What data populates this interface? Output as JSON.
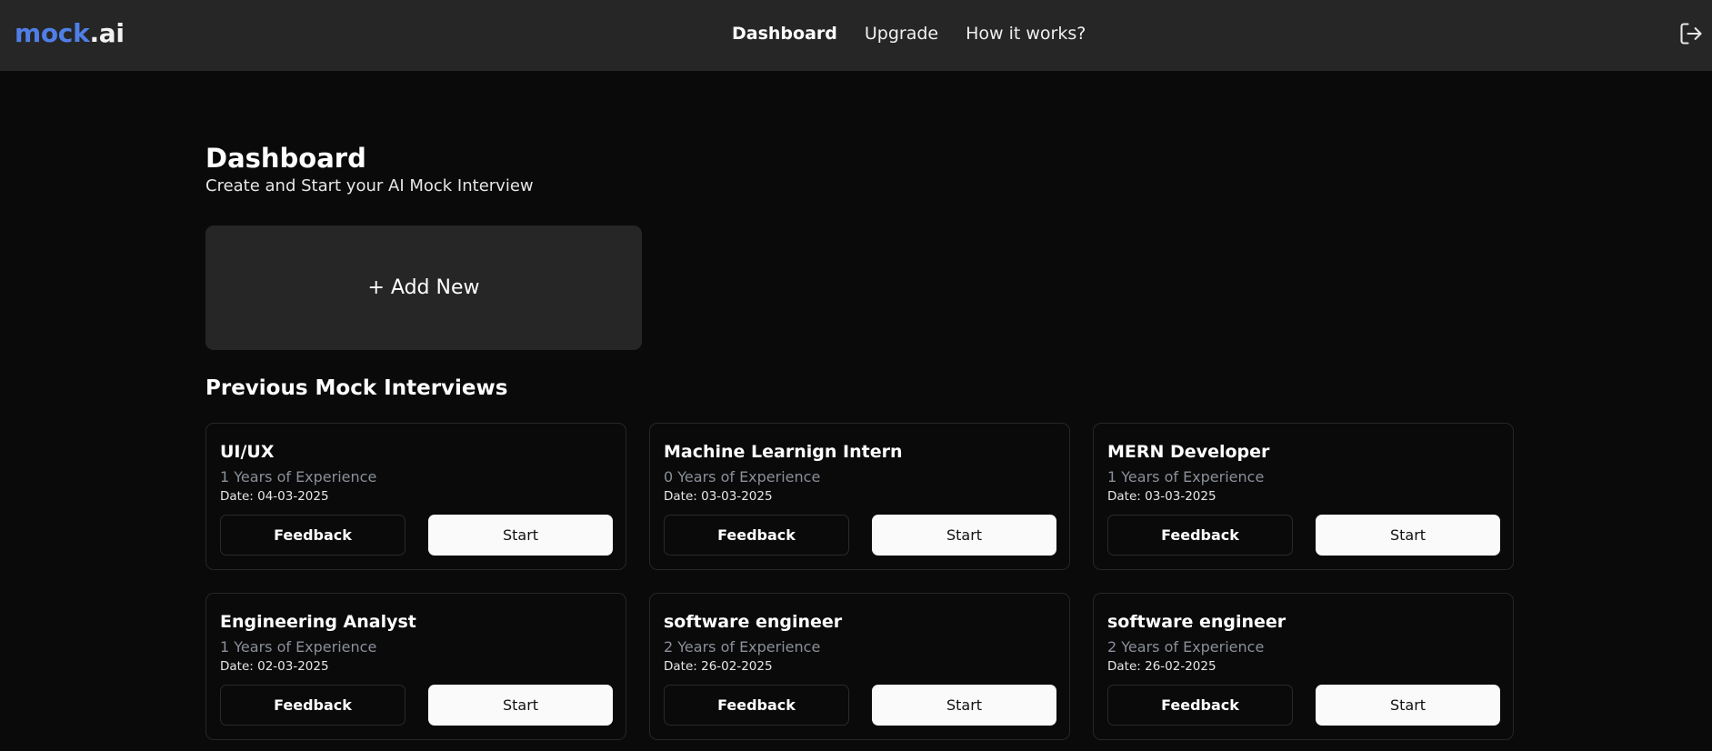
{
  "app": {
    "logo_part1": "mock",
    "logo_part2": ".ai"
  },
  "nav": {
    "items": [
      {
        "label": "Dashboard",
        "active": true
      },
      {
        "label": "Upgrade",
        "active": false
      },
      {
        "label": "How it works?",
        "active": false
      }
    ],
    "logout_icon": "logout-icon"
  },
  "page": {
    "title": "Dashboard",
    "subtitle": "Create and Start your AI Mock Interview",
    "add_new_label": "+ Add New",
    "section_title": "Previous Mock Interviews"
  },
  "interviews": [
    {
      "role": "UI/UX",
      "experience": "1 Years of Experience",
      "date": "Date: 04-03-2025",
      "feedback_label": "Feedback",
      "start_label": "Start"
    },
    {
      "role": "Machine Learnign Intern",
      "experience": "0 Years of Experience",
      "date": "Date: 03-03-2025",
      "feedback_label": "Feedback",
      "start_label": "Start"
    },
    {
      "role": "MERN Developer",
      "experience": "1 Years of Experience",
      "date": "Date: 03-03-2025",
      "feedback_label": "Feedback",
      "start_label": "Start"
    },
    {
      "role": "Engineering Analyst",
      "experience": "1 Years of Experience",
      "date": "Date: 02-03-2025",
      "feedback_label": "Feedback",
      "start_label": "Start"
    },
    {
      "role": "software engineer",
      "experience": "2 Years of Experience",
      "date": "Date: 26-02-2025",
      "feedback_label": "Feedback",
      "start_label": "Start"
    },
    {
      "role": "software engineer",
      "experience": "2 Years of Experience",
      "date": "Date: 26-02-2025",
      "feedback_label": "Feedback",
      "start_label": "Start"
    }
  ],
  "colors": {
    "logo_accent": "#4f7fe6",
    "background": "#0a0a0a",
    "header": "#262626"
  }
}
